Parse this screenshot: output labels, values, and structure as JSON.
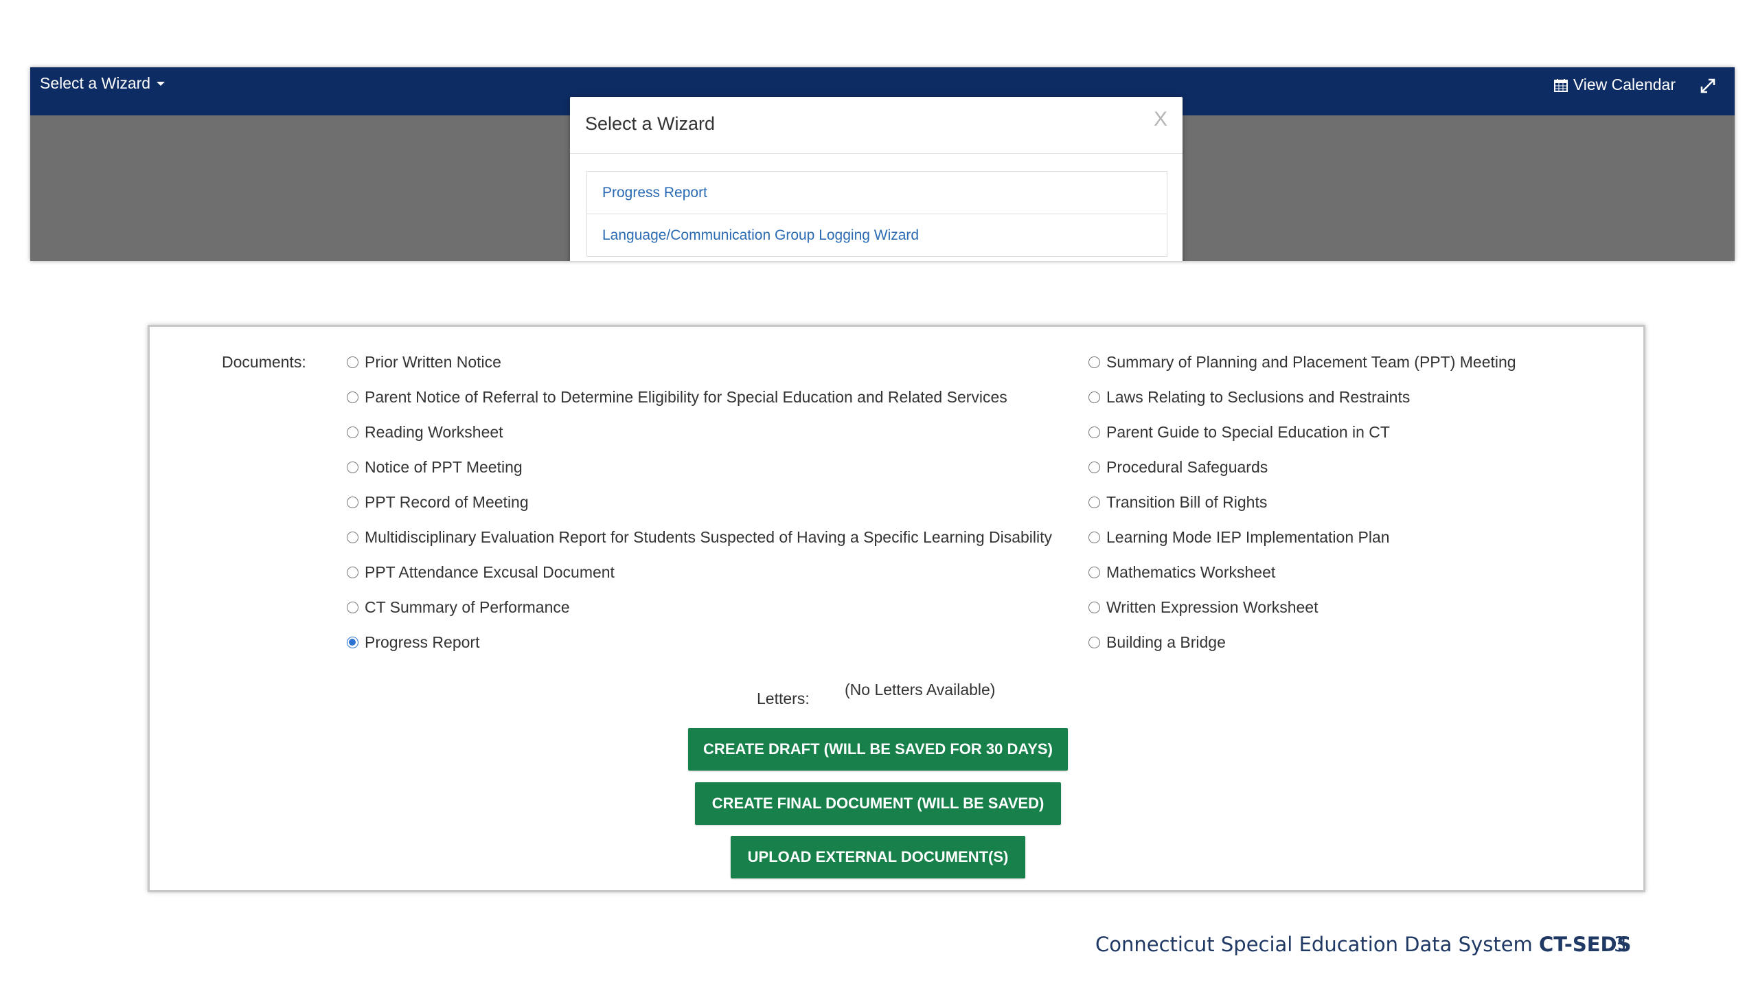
{
  "navbar": {
    "wizard_label": "Select a Wizard",
    "view_calendar_label": "View Calendar"
  },
  "modal": {
    "title": "Select a Wizard",
    "close_label": "X",
    "items": [
      "Progress Report",
      "Language/Communication Group Logging Wizard"
    ]
  },
  "form": {
    "documents_label": "Documents:",
    "documents_left": [
      "Prior Written Notice",
      "Parent Notice of Referral to Determine Eligibility for Special Education and Related Services",
      "Reading Worksheet",
      "Notice of PPT Meeting",
      "PPT Record of Meeting",
      "Multidisciplinary Evaluation Report for Students Suspected of Having a Specific Learning Disability",
      "PPT Attendance Excusal Document",
      "CT Summary of Performance",
      "Progress Report"
    ],
    "documents_right": [
      "Summary of Planning and Placement Team (PPT) Meeting",
      "Laws Relating to Seclusions and Restraints",
      "Parent Guide to Special Education in CT",
      "Procedural Safeguards",
      "Transition Bill of Rights",
      "Learning Mode IEP Implementation Plan",
      "Mathematics Worksheet",
      "Written Expression Worksheet",
      "Building a Bridge"
    ],
    "selected_document": "Progress Report",
    "letters_label": "Letters:",
    "letters_value": "(No Letters Available)",
    "buttons": {
      "draft": "CREATE DRAFT (WILL BE SAVED FOR 30 DAYS)",
      "final": "CREATE FINAL DOCUMENT (WILL BE SAVED)",
      "upload": "UPLOAD EXTERNAL DOCUMENT(S)"
    }
  },
  "footer": {
    "text": "Connecticut Special Education Data System ",
    "bold": "CT-SEDS",
    "page": "3"
  },
  "colors": {
    "navbar": "#0e2c64",
    "button_green": "#17804b",
    "link_blue": "#2a6bb3",
    "radio_selected": "#2b73d2",
    "footer_text": "#1f3864"
  }
}
